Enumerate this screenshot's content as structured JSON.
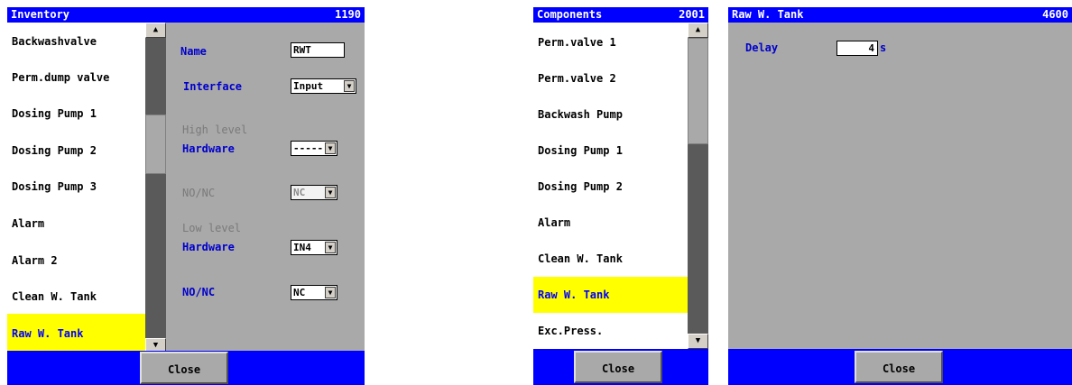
{
  "inventory": {
    "title": "Inventory",
    "number": "1190",
    "items": [
      "Backwashvalve",
      "Perm.dump valve",
      "Dosing Pump 1",
      "Dosing Pump 2",
      "Dosing Pump 3",
      "Alarm",
      "Alarm 2",
      "Clean W. Tank",
      "Raw W. Tank"
    ],
    "form": {
      "name_label": "Name",
      "name_value": "RWT",
      "interface_label": "Interface",
      "interface_value": "Input",
      "high_level_label": "High level",
      "hardware_label_1": "Hardware",
      "hardware_value_1": "-----",
      "nonc_label_1": "NO/NC",
      "nonc_value_1": "NC",
      "low_level_label": "Low level",
      "hardware_label_2": "Hardware",
      "hardware_value_2": "IN4",
      "nonc_label_2": "NO/NC",
      "nonc_value_2": "NC"
    },
    "close_label": "Close"
  },
  "components": {
    "title": "Components",
    "number": "2001",
    "items": [
      "Perm.valve 1",
      "Perm.valve 2",
      "Backwash Pump",
      "Dosing Pump 1",
      "Dosing Pump 2",
      "Alarm",
      "Clean W. Tank",
      "Raw W. Tank",
      "Exc.Press."
    ],
    "close_label": "Close"
  },
  "raw_tank": {
    "title": "Raw W. Tank",
    "number": "4600",
    "delay_label": "Delay",
    "delay_value": "4",
    "delay_unit": "s",
    "close_label": "Close"
  },
  "icons": {
    "scroll_up": "triangle-up",
    "scroll_down": "triangle-down",
    "dropdown": "triangle-down"
  },
  "colors": {
    "title_bar": "#0000ff",
    "panel": "#a9a9a9",
    "selection": "#ffff00",
    "label": "#0000cc"
  }
}
